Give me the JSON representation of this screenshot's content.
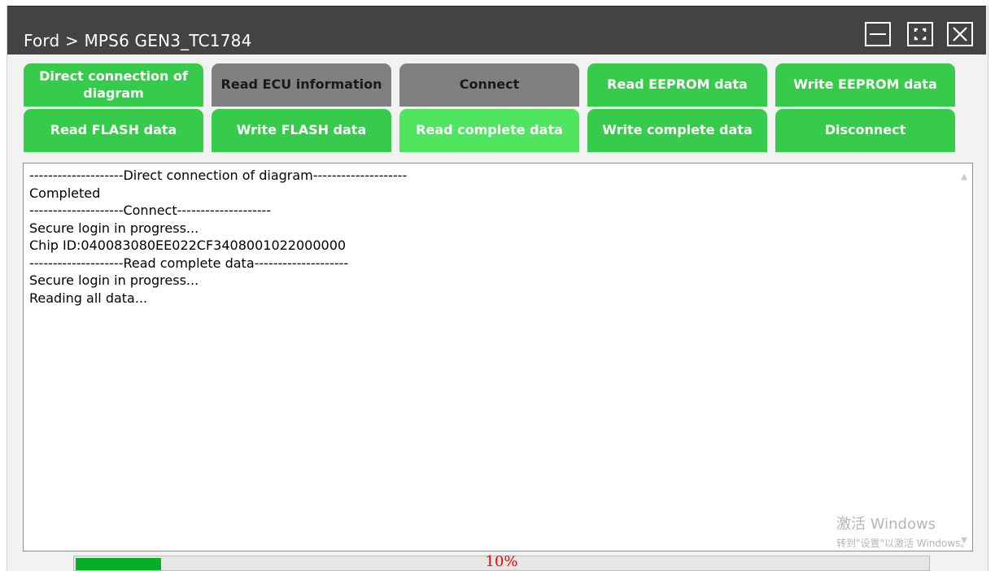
{
  "window": {
    "title": "Ford > MPS6 GEN3_TC1784",
    "controls": {
      "minimize_icon": "minimize-icon",
      "maximize_icon": "fullscreen-icon",
      "close_icon": "close-icon"
    }
  },
  "buttons": [
    {
      "label": "Direct connection of diagram",
      "state": "enabled"
    },
    {
      "label": "Read ECU information",
      "state": "disabled"
    },
    {
      "label": "Connect",
      "state": "disabled"
    },
    {
      "label": "Read EEPROM data",
      "state": "enabled"
    },
    {
      "label": "Write EEPROM data",
      "state": "enabled"
    },
    {
      "label": "Read FLASH data",
      "state": "enabled"
    },
    {
      "label": "Write FLASH data",
      "state": "enabled"
    },
    {
      "label": "Read complete data",
      "state": "active"
    },
    {
      "label": "Write complete data",
      "state": "enabled"
    },
    {
      "label": "Disconnect",
      "state": "enabled"
    }
  ],
  "log": {
    "lines": [
      "--------------------Direct connection of diagram--------------------",
      "Completed",
      "--------------------Connect--------------------",
      "Secure login in progress...",
      "Chip ID:040083080EE022CF3408001022000000",
      "--------------------Read complete data--------------------",
      "Secure login in progress...",
      "Reading all data..."
    ]
  },
  "watermark": {
    "line1": "激活 Windows",
    "line2": "转到\"设置\"以激活 Windows。"
  },
  "progress": {
    "value": 0.1,
    "label": "10%"
  },
  "colors": {
    "titlebar": "#434343",
    "button_green": "#36cb4a",
    "button_active": "#4fe55e",
    "button_gray": "#808080",
    "progress_fill": "#06b025",
    "progress_text": "#ff0000"
  }
}
